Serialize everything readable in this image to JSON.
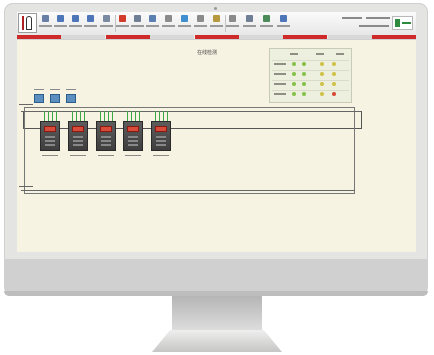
{
  "app": {
    "tab_colors": [
      "#cf2a2a",
      "#d8d8d8",
      "#cf2a2a",
      "#d8d8d8",
      "#cf2a2a",
      "#d8d8d8",
      "#cf2a2a",
      "#d8d8d8",
      "#cf2a2a"
    ]
  },
  "screen": {
    "title": "在线检测"
  },
  "toolbar": {
    "buttons": [
      {
        "icon": "save-icon",
        "color": "#6a7fa6"
      },
      {
        "icon": "back-icon",
        "color": "#4c76b8"
      },
      {
        "icon": "forward-icon",
        "color": "#4c76b8"
      },
      {
        "icon": "arrow-right-icon",
        "color": "#4c76b8"
      },
      {
        "icon": "tool-icon",
        "color": "#7a8aa0"
      },
      {
        "icon": "stop-icon",
        "color": "#d23b2a"
      },
      {
        "icon": "gear-icon",
        "color": "#6f7f95"
      },
      {
        "icon": "monitor-icon",
        "color": "#5b7fb0"
      },
      {
        "icon": "grid-icon",
        "color": "#8b8b8b"
      },
      {
        "icon": "globe-icon",
        "color": "#3e8ed0"
      },
      {
        "icon": "wrench-icon",
        "color": "#8b8b8b"
      },
      {
        "icon": "key-icon",
        "color": "#b89a3e"
      },
      {
        "icon": "exit-icon",
        "color": "#8b8b8b"
      },
      {
        "icon": "print-icon",
        "color": "#6f7f95"
      },
      {
        "icon": "report-icon",
        "color": "#4c8c5a"
      },
      {
        "icon": "help-icon",
        "color": "#4c76b8"
      }
    ]
  },
  "diagram": {
    "meter_color": "#5c8fbf",
    "panel_display_color": "#d84a3a",
    "wire_color": "#39a845",
    "status_cell_colors": [
      "#86c24a",
      "#d0c24a",
      "#d64a3a"
    ]
  }
}
